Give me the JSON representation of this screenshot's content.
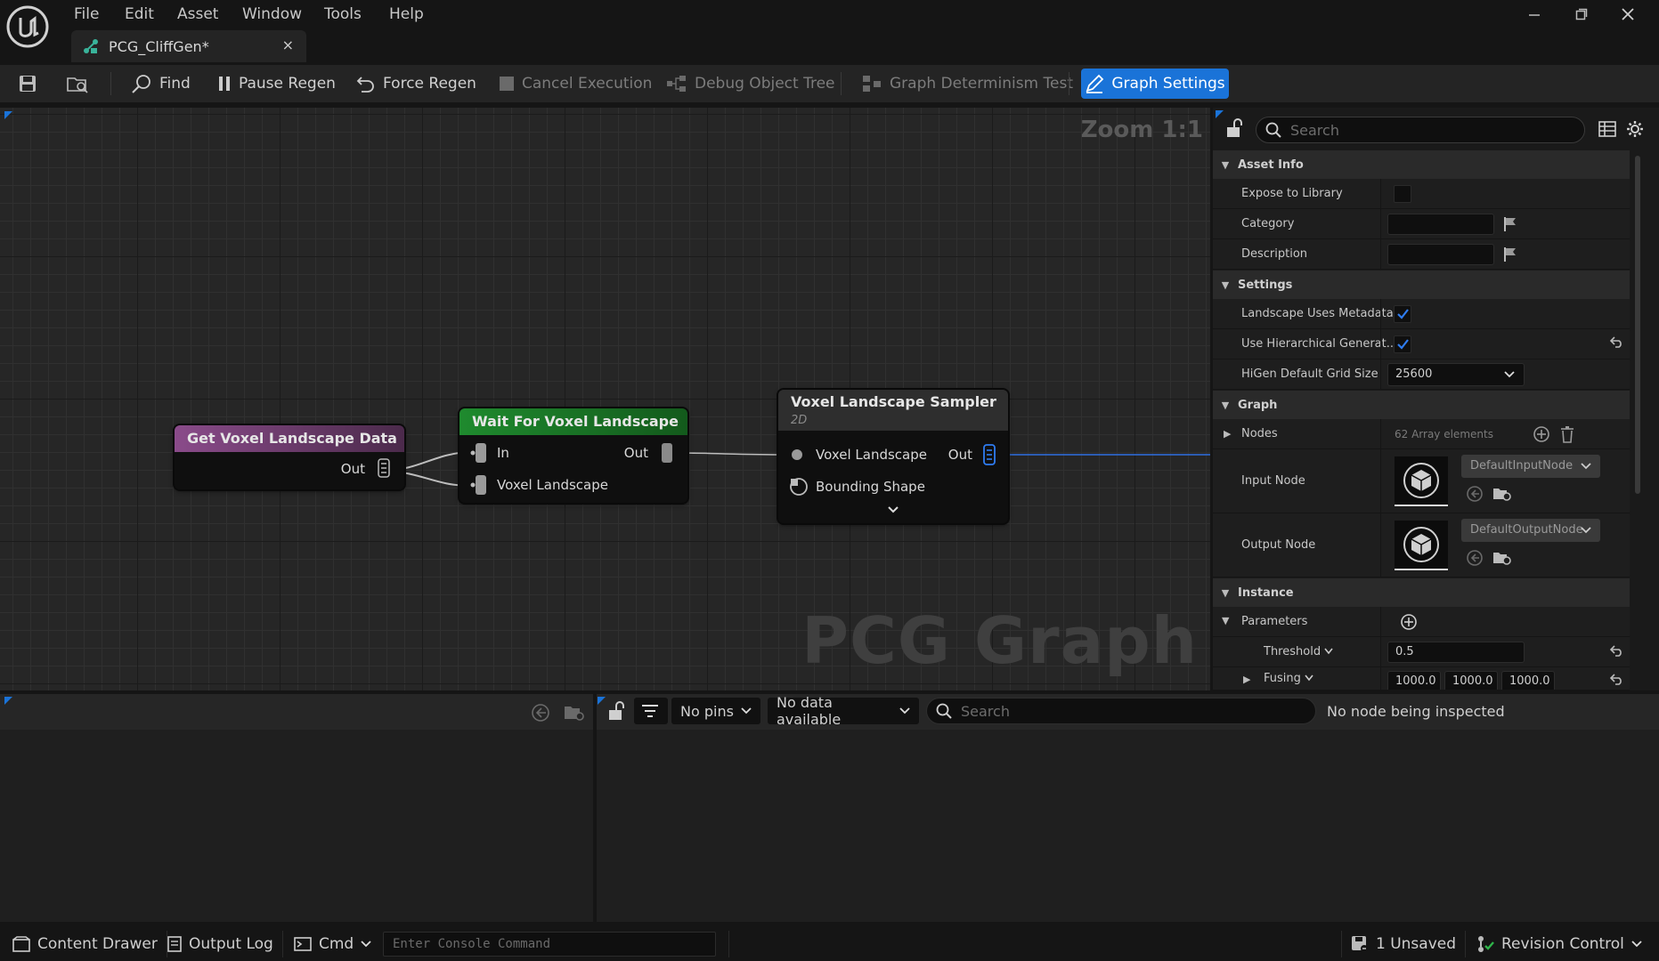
{
  "menu": {
    "file": "File",
    "edit": "Edit",
    "asset": "Asset",
    "window": "Window",
    "tools": "Tools",
    "help": "Help"
  },
  "tab": {
    "title": "PCG_CliffGen*",
    "close": "×"
  },
  "toolbar": {
    "find": "Find",
    "pause_regen": "Pause Regen",
    "force_regen": "Force Regen",
    "cancel_execution": "Cancel Execution",
    "debug_object_tree": "Debug Object Tree",
    "graph_determinism_test": "Graph Determinism Test",
    "graph_settings": "Graph Settings"
  },
  "graph": {
    "zoom": "Zoom 1:1",
    "watermark": "PCG Graph",
    "nodes": {
      "get_data": {
        "title": "Get Voxel Landscape Data",
        "out": "Out",
        "color": "#8a4b8a"
      },
      "wait": {
        "title": "Wait For Voxel Landscape",
        "in": "In",
        "out": "Out",
        "voxel": "Voxel Landscape",
        "color": "#1f8a2e"
      },
      "sampler": {
        "title": "Voxel Landscape Sampler",
        "subtitle": "2D",
        "voxel": "Voxel Landscape",
        "out": "Out",
        "bounding": "Bounding Shape",
        "color": "#2e2e2e"
      }
    }
  },
  "details": {
    "search_placeholder": "Search",
    "asset_info": "Asset Info",
    "expose_to_library": "Expose to Library",
    "category": "Category",
    "description": "Description",
    "settings": "Settings",
    "landscape_uses_metadata": "Landscape Uses Metadata",
    "use_hierarchical": "Use Hierarchical Generat...",
    "higen_grid_size_label": "HiGen Default Grid Size",
    "higen_grid_size_value": "25600",
    "graph_cat": "Graph",
    "nodes_label": "Nodes",
    "nodes_value": "62 Array elements",
    "input_node_label": "Input Node",
    "input_node_value": "DefaultInputNode",
    "output_node_label": "Output Node",
    "output_node_value": "DefaultOutputNode",
    "instance": "Instance",
    "parameters": "Parameters",
    "threshold_label": "Threshold",
    "threshold_value": "0.5",
    "fusing_label": "Fusing",
    "fusing_x": "1000.0",
    "fusing_y": "1000.0",
    "fusing_z": "1000.0"
  },
  "bottom": {
    "no_pins": "No pins",
    "no_data": "No data available",
    "search_placeholder": "Search",
    "no_node": "No node being inspected"
  },
  "status": {
    "content_drawer": "Content Drawer",
    "output_log": "Output Log",
    "cmd": "Cmd",
    "console_placeholder": "Enter Console Command",
    "unsaved": "1 Unsaved",
    "revision_control": "Revision Control"
  },
  "colors": {
    "accent": "#1a73d8",
    "check": "#1a73d8",
    "wire_blue": "#2f6fe0"
  }
}
